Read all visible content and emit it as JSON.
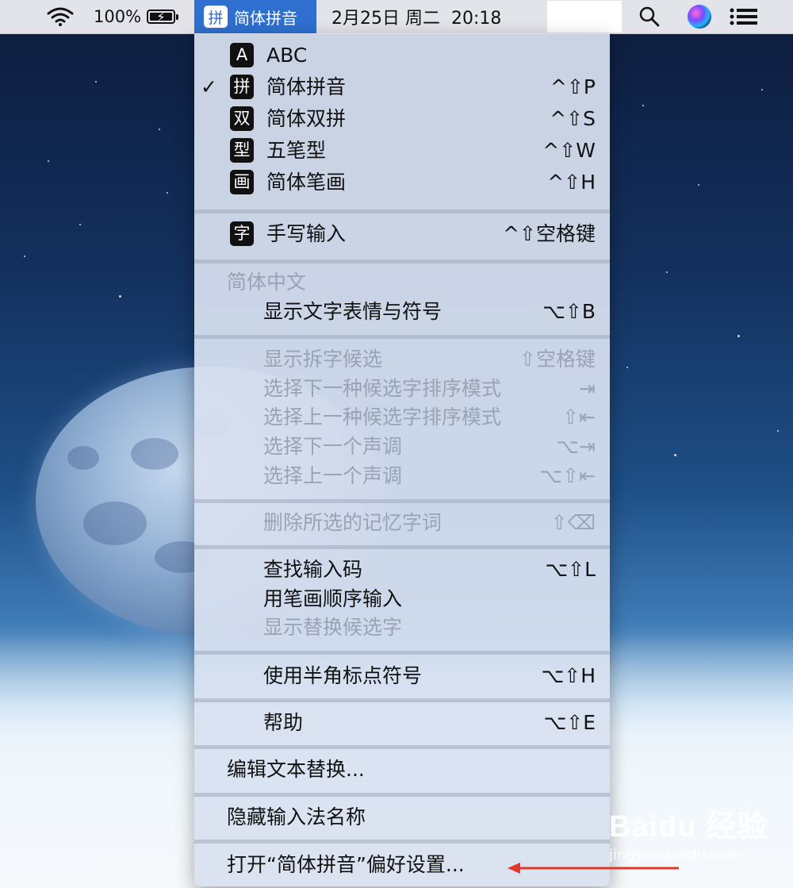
{
  "menubar": {
    "battery_pct": "100%",
    "ime_glyph": "拼",
    "ime_name": "简体拼音",
    "clock": "2月25日 周二  20:18"
  },
  "menu": {
    "input_sources": [
      {
        "badge": "A",
        "label": "ABC",
        "shortcut": "",
        "checked": false
      },
      {
        "badge": "拼",
        "label": "简体拼音",
        "shortcut": "^⇧P",
        "checked": true
      },
      {
        "badge": "双",
        "label": "简体双拼",
        "shortcut": "^⇧S",
        "checked": false
      },
      {
        "badge": "型",
        "label": "五笔型",
        "shortcut": "^⇧W",
        "checked": false
      },
      {
        "badge": "画",
        "label": "简体笔画",
        "shortcut": "^⇧H",
        "checked": false
      }
    ],
    "handwriting": {
      "badge": "字",
      "label": "手写输入",
      "shortcut": "^⇧空格键"
    },
    "section_header": "简体中文",
    "emoji": {
      "label": "显示文字表情与符号",
      "shortcut": "⌥⇧B"
    },
    "candidates": [
      {
        "label": "显示拆字候选",
        "shortcut": "⇧空格键",
        "enabled": false
      },
      {
        "label": "选择下一种候选字排序模式",
        "shortcut": "⇥",
        "enabled": false
      },
      {
        "label": "选择上一种候选字排序模式",
        "shortcut": "⇧⇤",
        "enabled": false
      },
      {
        "label": "选择下一个声调",
        "shortcut": "⌥⇥",
        "enabled": false
      },
      {
        "label": "选择上一个声调",
        "shortcut": "⌥⇧⇤",
        "enabled": false
      }
    ],
    "delete_memory": {
      "label": "删除所选的记忆字词",
      "shortcut": "⇧⌫",
      "enabled": false
    },
    "lookup": [
      {
        "label": "查找输入码",
        "shortcut": "⌥⇧L",
        "enabled": true
      },
      {
        "label": "用笔画顺序输入",
        "shortcut": "",
        "enabled": true
      },
      {
        "label": "显示替换候选字",
        "shortcut": "",
        "enabled": false
      }
    ],
    "halfwidth": {
      "label": "使用半角标点符号",
      "shortcut": "⌥⇧H"
    },
    "help": {
      "label": "帮助",
      "shortcut": "⌥⇧E"
    },
    "edit_replacements": "编辑文本替换...",
    "hide_name": "隐藏输入法名称",
    "open_prefs": "打开“简体拼音”偏好设置..."
  },
  "annotation": {
    "arrow_color": "#e0392b"
  },
  "watermark": {
    "logo": "Baidu 经验",
    "url": "jingyan.baidu.com"
  }
}
